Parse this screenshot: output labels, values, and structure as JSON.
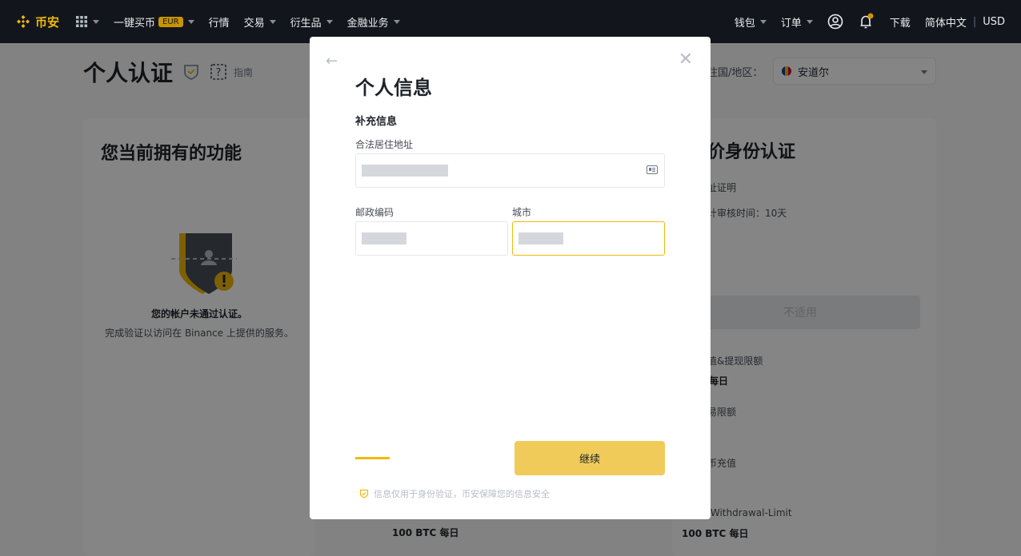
{
  "nav": {
    "logo": "币安",
    "items": [
      "一键买币",
      "行情",
      "交易",
      "衍生品",
      "金融业务"
    ],
    "eur_badge": "EUR",
    "right": {
      "wallet": "钱包",
      "orders": "订单",
      "download": "下载",
      "language": "简体中文",
      "currency": "USD"
    }
  },
  "page": {
    "title": "个人认证",
    "guide": "指南",
    "region_label": "住国/地区：",
    "region_value": "安道尔",
    "left_card": {
      "title": "您当前拥有的功能",
      "status": "您的帐户未通过认证。",
      "status_sub": "完成验证以访问在 Binance 上提供的服务。"
    },
    "right_card": {
      "title": "价身份认证",
      "line1": "址证明",
      "line2": "计审核时间：10天",
      "na_button": "不适用",
      "limit1": "值&提现限额",
      "limit1_val": "每日",
      "limit2": "易限额",
      "limit3": "币充值",
      "limit4": "-Withdrawal-Limit",
      "limit4_val": "100 BTC 每日"
    },
    "middle_bottom": "100 BTC 每日"
  },
  "modal": {
    "title": "个人信息",
    "section": "补充信息",
    "address_label": "合法居住地址",
    "postal_label": "邮政编码",
    "city_label": "城市",
    "continue_label": "继续",
    "progress": 0.25,
    "privacy": "信息仅用于身份验证，币安保障您的信息安全"
  },
  "colors": {
    "brand": "#f0b90b",
    "nav_bg": "#12161c"
  }
}
